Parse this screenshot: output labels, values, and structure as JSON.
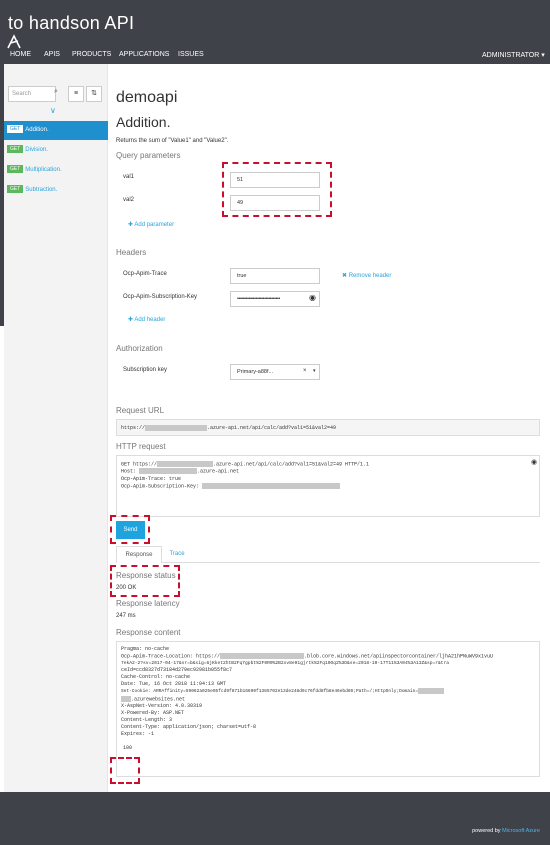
{
  "header": {
    "brand": "to handson API",
    "nav": [
      "HOME",
      "APIS",
      "PRODUCTS",
      "APPLICATIONS",
      "ISSUES"
    ],
    "user_menu": "ADMINISTRATOR ▾"
  },
  "sidebar": {
    "search_placeholder": "Search",
    "operations": [
      {
        "method": "GET",
        "label": "Addition."
      },
      {
        "method": "GET",
        "label": "Division."
      },
      {
        "method": "GET",
        "label": "Multiplication."
      },
      {
        "method": "GET",
        "label": "Subtraction."
      }
    ]
  },
  "main": {
    "api_title": "demoapi",
    "operation_title": "Addition.",
    "description": "Returns the sum of \"Value1\" and \"Value2\".",
    "query_section": "Query parameters",
    "params": [
      {
        "name": "val1",
        "value": "51"
      },
      {
        "name": "val2",
        "value": "49"
      }
    ],
    "add_parameter": "Add parameter",
    "headers_section": "Headers",
    "headers": [
      {
        "name": "Ocp-Apim-Trace",
        "value": "true"
      },
      {
        "name": "Ocp-Apim-Subscription-Key",
        "value": "••••••••••••••••••••••••••••••"
      }
    ],
    "remove_header": "Remove header",
    "add_header": "Add header",
    "auth_section": "Authorization",
    "subscription_key_label": "Subscription key",
    "subscription_key_value": "Primary-a88f...",
    "request_url_section": "Request URL",
    "request_url_prefix": "https://",
    "request_url_suffix": ".azure-api.net/api/calc/add?val1=51&val2=49",
    "http_request_section": "HTTP request",
    "http_request": {
      "line1_prefix": "GET https://",
      "line1_suffix": ".azure-api.net/api/calc/add?val1=51&val2=49 HTTP/1.1",
      "host_prefix": "Host:",
      "host_suffix": ".azure-api.net",
      "trace": "Ocp-Apim-Trace: true",
      "subkey_prefix": "Ocp-Apim-Subscription-Key:"
    },
    "send_button": "Send",
    "tabs": [
      "Response",
      "Trace"
    ],
    "response_status_label": "Response status",
    "response_status_value": "200 OK",
    "response_latency_label": "Response latency",
    "response_latency_value": "247 ms",
    "response_content_label": "Response content",
    "response_lines": {
      "pragma": "Pragma: no-cache",
      "trace_loc_prefix": "Ocp-Apim-Trace-Location: https://",
      "trace_loc_suffix": ".blob.core.windows.net/apiinspectorcontainer/ljhA21hPNuWV9x1vuU",
      "trace_loc_2": "7ekA2-2?sv=2017-04-17&sr=b&sig=6jKket2htB2Fq7gpbt%2F0R0%2B2xv8e91gjrtk%2Fq10Oq2%3D&se=2018-10-17T11%3A04%3A13Z&sp=r&tra",
      "trace_loc_3": "ceId=ccd8327d73184d279ec92981b055f8c7",
      "cache_control": "Cache-Control: no-cache",
      "date": "Date: Tue, 16 Oct 2018 11:04:13 GMT",
      "cookie_prefix": "Set-Cookie: ARRAffinity=59062a025e05fcd9f871b16690f1385702e13de248d9c76fdd8fb8e46ebd89;Path=/;HttpOnly;Domain=",
      "cookie_suffix": ".azurewebsites.net",
      "aspnet": "X-AspNet-Version: 4.0.30319",
      "powered": "X-Powered-By: ASP.NET",
      "content_length": "Content-Length: 3",
      "content_type": "Content-Type: application/json; charset=utf-8",
      "expires": "Expires: -1",
      "body": "100"
    }
  },
  "footer": {
    "powered_by": "powered by",
    "brand": "Microsoft Azure"
  },
  "colors": {
    "accent": "#2aa4dc",
    "highlight": "#c8102e",
    "get_badge": "#5cb85c",
    "topbar": "#3f4248"
  }
}
